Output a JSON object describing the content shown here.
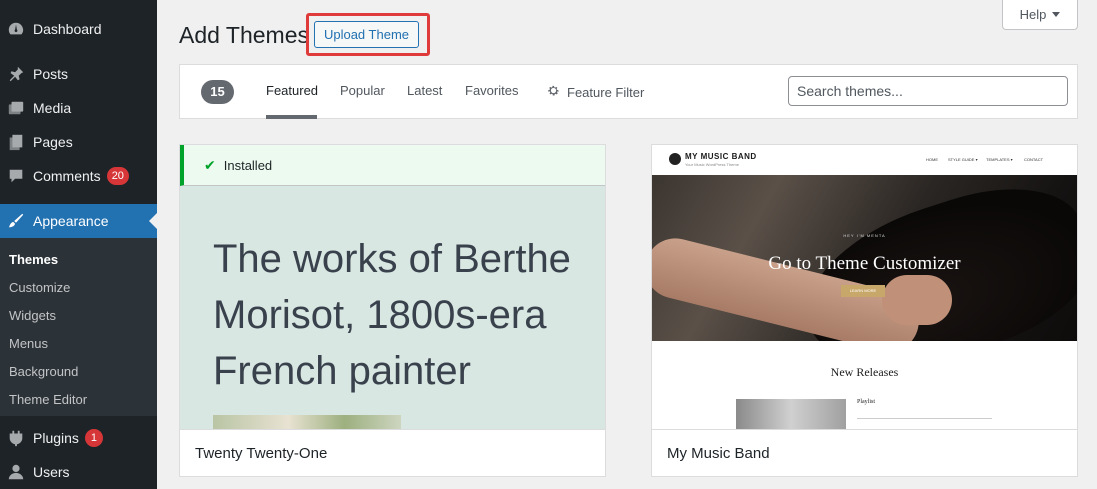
{
  "sidebar": {
    "items": [
      {
        "label": "Dashboard",
        "icon": "dashboard-icon"
      },
      {
        "label": "Posts",
        "icon": "pin-icon"
      },
      {
        "label": "Media",
        "icon": "media-icon"
      },
      {
        "label": "Pages",
        "icon": "pages-icon"
      },
      {
        "label": "Comments",
        "icon": "comment-icon",
        "badge": "20"
      },
      {
        "label": "Appearance",
        "icon": "brush-icon",
        "active": true
      },
      {
        "label": "Plugins",
        "icon": "plugin-icon",
        "badge": "1"
      },
      {
        "label": "Users",
        "icon": "user-icon"
      }
    ],
    "submenu": [
      "Themes",
      "Customize",
      "Widgets",
      "Menus",
      "Background",
      "Theme Editor"
    ]
  },
  "header": {
    "title": "Add Themes",
    "upload_label": "Upload Theme",
    "help_label": "Help"
  },
  "filter_bar": {
    "count": "15",
    "tabs": [
      "Featured",
      "Popular",
      "Latest",
      "Favorites"
    ],
    "feature_filter": "Feature Filter",
    "search_placeholder": "Search themes..."
  },
  "themes": [
    {
      "name": "Twenty Twenty-One",
      "installed_label": "Installed",
      "preview_heading": "The works of Berthe Morisot, 1800s-era French painter"
    },
    {
      "name": "My Music Band",
      "preview": {
        "site_title": "MY MUSIC BAND",
        "tagline": "Your Music WordPress Theme",
        "nav": [
          "HOME",
          "STYLE GUIDE ▾",
          "TEMPLATES ▾",
          "CONTACT"
        ],
        "hero_small": "HEY I'M MENTA",
        "hero_title": "Go to Theme Customizer",
        "hero_button": "LEARN MORE",
        "section_title": "New Releases",
        "playlist_label": "Playlist"
      }
    }
  ],
  "colors": {
    "sidebar_bg": "#1d2327",
    "accent": "#2271b1",
    "badge": "#d63638",
    "highlight": "#e03b3b",
    "installed_green": "#00a32a"
  }
}
